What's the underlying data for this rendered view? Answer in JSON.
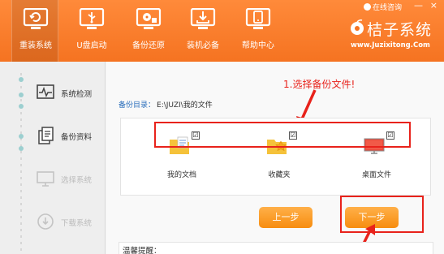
{
  "nav": {
    "items": [
      {
        "label": "重装系统",
        "icon": "monitor-refresh-icon"
      },
      {
        "label": "U盘启动",
        "icon": "usb-icon"
      },
      {
        "label": "备份还原",
        "icon": "backup-disk-icon"
      },
      {
        "label": "装机必备",
        "icon": "download-tray-icon"
      },
      {
        "label": "帮助中心",
        "icon": "help-phone-icon"
      }
    ],
    "active": "重装系统"
  },
  "top_right": {
    "online_help": "在线咨询",
    "minimize": "—",
    "close": "×"
  },
  "brand": {
    "name": "桔子系统",
    "url": "www.Juzixitong.Com"
  },
  "sidebar": {
    "steps": [
      {
        "label": "系统检测",
        "icon": "activity-monitor-icon",
        "enabled": true
      },
      {
        "label": "备份资料",
        "icon": "documents-icon",
        "enabled": true
      },
      {
        "label": "选择系统",
        "icon": "monitor-icon",
        "enabled": false
      },
      {
        "label": "下载系统",
        "icon": "download-icon",
        "enabled": false
      }
    ]
  },
  "main": {
    "backup_dir_label": "备份目录：",
    "backup_dir_path": "E:\\JUZI\\我的文件",
    "files": [
      {
        "label": "我的文档",
        "icon": "my-documents-icon",
        "checked": true
      },
      {
        "label": "收藏夹",
        "icon": "favorites-folder-icon",
        "checked": true
      },
      {
        "label": "桌面文件",
        "icon": "desktop-icon",
        "checked": true
      }
    ],
    "check_mark": "☑",
    "prev_button": "上一步",
    "next_button": "下一步",
    "tips_title": "温馨提醒："
  },
  "annotation": {
    "text": "1.选择备份文件!",
    "color": "#e8221b"
  },
  "colors": {
    "accent": "#f57321",
    "button": "#f78d10",
    "annotation_red": "#e8221b",
    "link_blue": "#2a6ebb"
  }
}
